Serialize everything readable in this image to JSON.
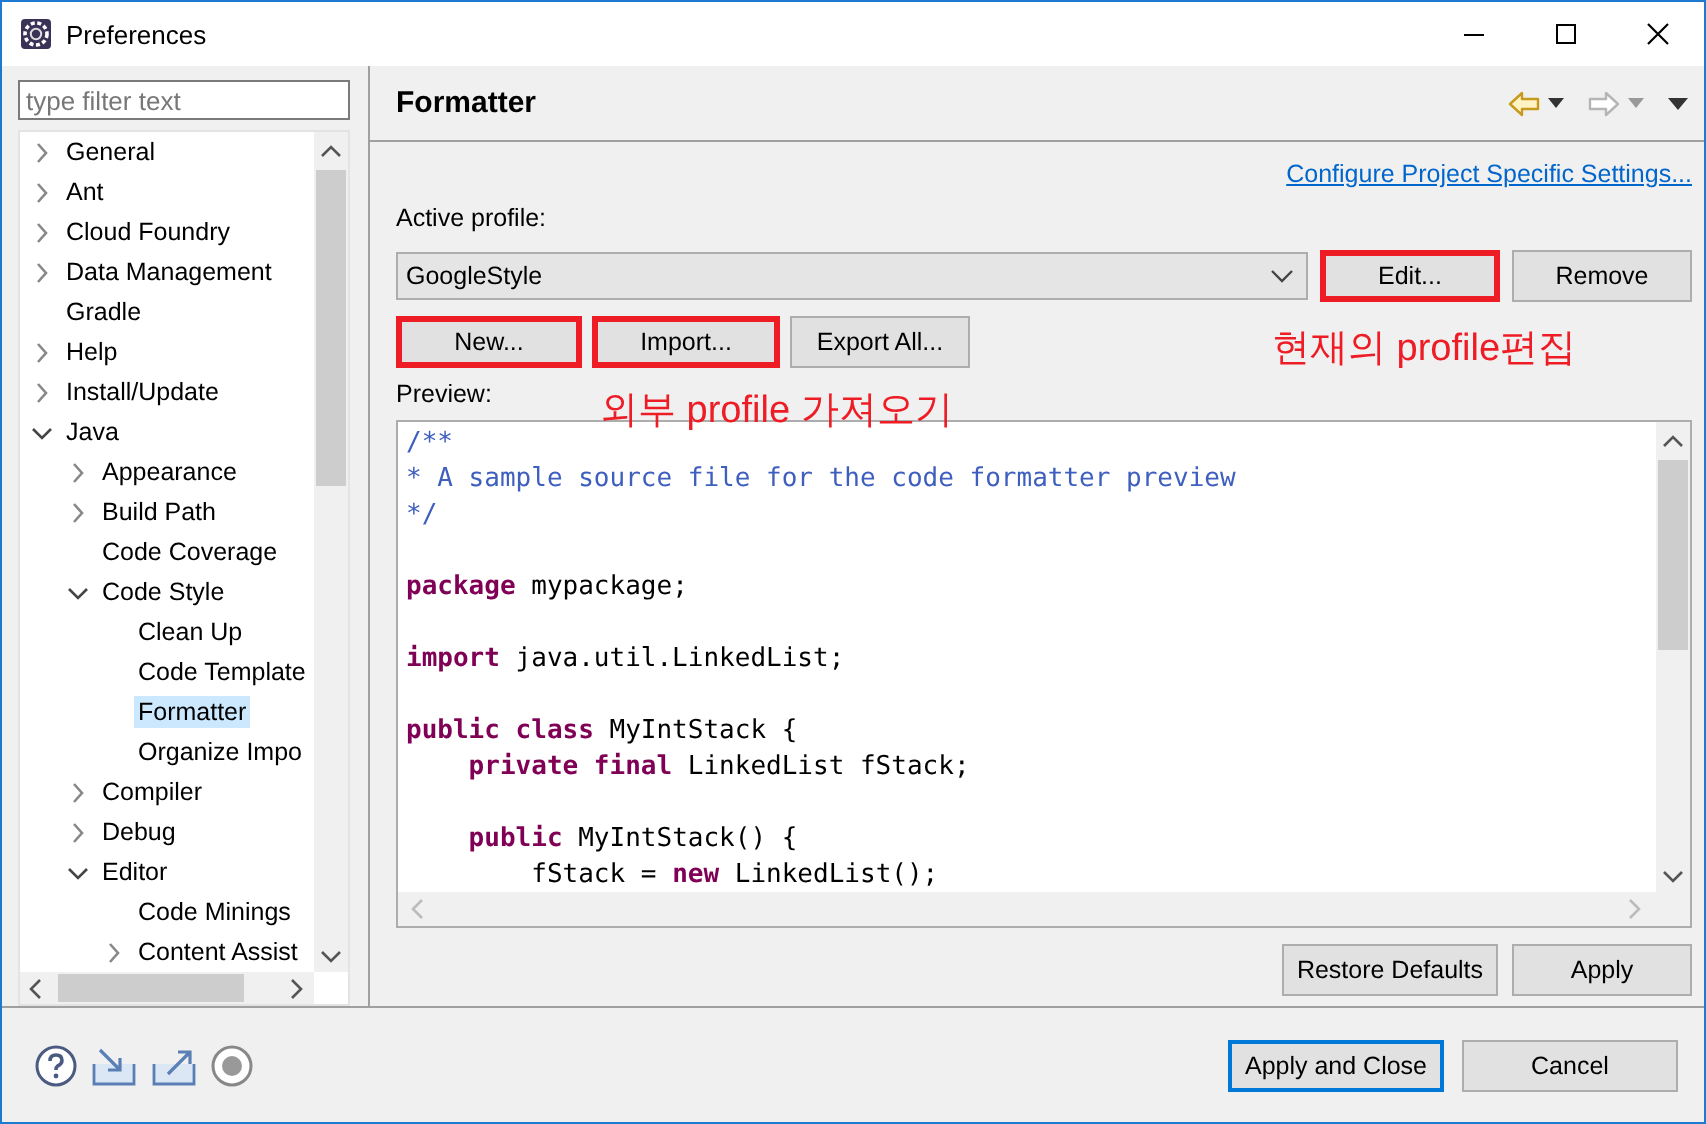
{
  "window": {
    "title": "Preferences"
  },
  "filter": {
    "placeholder": "type filter text"
  },
  "tree": [
    {
      "label": "General",
      "expanded": false,
      "selected": false
    },
    {
      "label": "Ant",
      "expanded": false,
      "selected": false
    },
    {
      "label": "Cloud Foundry",
      "expanded": false,
      "selected": false
    },
    {
      "label": "Data Management",
      "expanded": false,
      "selected": false
    },
    {
      "label": "Gradle",
      "selected": false
    },
    {
      "label": "Help",
      "expanded": false,
      "selected": false
    },
    {
      "label": "Install/Update",
      "expanded": false,
      "selected": false
    },
    {
      "label": "Java",
      "expanded": true,
      "selected": false,
      "children": [
        {
          "label": "Appearance",
          "expanded": false,
          "selected": false
        },
        {
          "label": "Build Path",
          "expanded": false,
          "selected": false
        },
        {
          "label": "Code Coverage",
          "selected": false
        },
        {
          "label": "Code Style",
          "expanded": true,
          "selected": false,
          "children": [
            {
              "label": "Clean Up",
              "selected": false
            },
            {
              "label": "Code Template",
              "selected": false
            },
            {
              "label": "Formatter",
              "selected": true
            },
            {
              "label": "Organize Impo",
              "selected": false
            }
          ]
        },
        {
          "label": "Compiler",
          "expanded": false,
          "selected": false
        },
        {
          "label": "Debug",
          "expanded": false,
          "selected": false
        },
        {
          "label": "Editor",
          "expanded": true,
          "selected": false,
          "children": [
            {
              "label": "Code Minings",
              "selected": false
            },
            {
              "label": "Content Assist",
              "expanded": false,
              "selected": false
            }
          ]
        }
      ]
    }
  ],
  "page": {
    "title": "Formatter",
    "link": "Configure Project Specific Settings...",
    "profile_label": "Active profile:",
    "profile": {
      "value": "GoogleStyle"
    },
    "profile_buttons": [
      {
        "label": "Edit...",
        "highlighted": true
      },
      {
        "label": "Remove",
        "highlighted": false
      }
    ],
    "action_buttons": [
      {
        "label": "New...",
        "highlighted": true
      },
      {
        "label": "Import...",
        "highlighted": true
      },
      {
        "label": "Export All...",
        "highlighted": false
      }
    ],
    "preview_label": "Preview:",
    "preview_lines": [
      {
        "kind": "code",
        "segments": [
          {
            "kind": "comment",
            "text": "/**"
          }
        ]
      },
      {
        "kind": "code",
        "segments": [
          {
            "kind": "comment",
            "text": "* A sample source file for the code formatter preview"
          }
        ]
      },
      {
        "kind": "code",
        "segments": [
          {
            "kind": "comment",
            "text": "*/"
          }
        ]
      },
      {
        "kind": "blank"
      },
      {
        "kind": "code",
        "segments": [
          {
            "kind": "keyword",
            "text": "package"
          },
          {
            "kind": "plain",
            "text": " mypackage;"
          }
        ]
      },
      {
        "kind": "blank"
      },
      {
        "kind": "code",
        "segments": [
          {
            "kind": "keyword",
            "text": "import"
          },
          {
            "kind": "plain",
            "text": " java.util.LinkedList;"
          }
        ]
      },
      {
        "kind": "blank"
      },
      {
        "kind": "code",
        "segments": [
          {
            "kind": "keyword",
            "text": "public class"
          },
          {
            "kind": "plain",
            "text": " MyIntStack {"
          }
        ]
      },
      {
        "kind": "code",
        "segments": [
          {
            "kind": "keyword",
            "text": "    private final"
          },
          {
            "kind": "plain",
            "text": " LinkedList fStack;"
          }
        ]
      },
      {
        "kind": "blank"
      },
      {
        "kind": "code",
        "segments": [
          {
            "kind": "keyword",
            "text": "    public"
          },
          {
            "kind": "plain",
            "text": " MyIntStack() {"
          }
        ]
      },
      {
        "kind": "code",
        "segments": [
          {
            "kind": "plain",
            "text": "        fStack = "
          },
          {
            "kind": "keyword",
            "text": "new"
          },
          {
            "kind": "plain",
            "text": " LinkedList();"
          }
        ]
      }
    ],
    "page_buttons": [
      {
        "label": "Restore Defaults"
      },
      {
        "label": "Apply"
      }
    ]
  },
  "annotations": [
    {
      "text": "현재의 profile편집"
    },
    {
      "text": "외부 profile 가져오기"
    }
  ],
  "dialog_buttons": [
    {
      "label": "Apply and Close",
      "default": true
    },
    {
      "label": "Cancel",
      "default": false
    }
  ]
}
